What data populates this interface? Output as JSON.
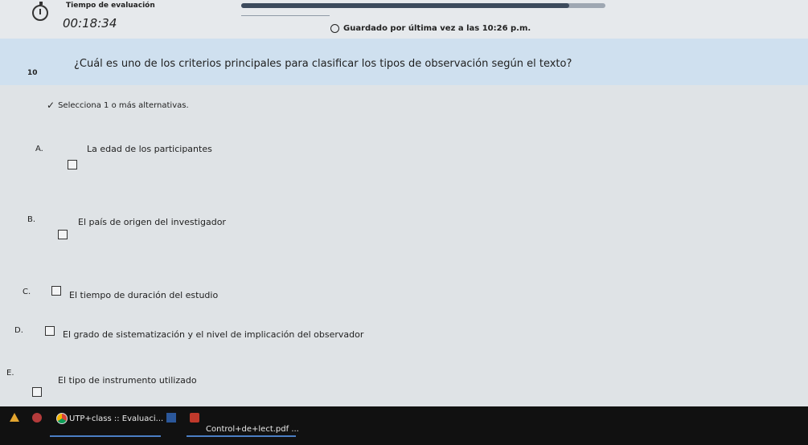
{
  "timer": {
    "title": "Tiempo de evaluación",
    "value": "00:18:34",
    "progress_fraction": 0.9
  },
  "saved": {
    "text": "Guardado por última vez a las 10:26 p.m."
  },
  "question": {
    "number": "10",
    "text": "¿Cuál es uno de los criterios principales para clasificar los tipos de observación según el texto?",
    "hint": "Selecciona 1 o más alternativas.",
    "options": [
      {
        "letter": "A.",
        "text": "La edad de los participantes",
        "checked": false
      },
      {
        "letter": "B.",
        "text": "El país de origen del investigador",
        "checked": false
      },
      {
        "letter": "C.",
        "text": "El tiempo de duración del estudio",
        "checked": false
      },
      {
        "letter": "D.",
        "text": "El grado de sistematización y el nivel de implicación del observador",
        "checked": false
      },
      {
        "letter": "E.",
        "text": "El tipo de instrumento utilizado",
        "checked": false
      }
    ]
  },
  "taskbar": {
    "apps": [
      {
        "label": "UTP+class :: Evaluaci...",
        "icon": "chrome-icon"
      },
      {
        "label": "Control+de+lect.pdf ...",
        "icon": "pdf-icon"
      }
    ]
  },
  "colors": {
    "question_bar": "#cfe0ef",
    "page_bg": "#dfe3e6",
    "taskbar": "#111111",
    "progress_fill": "#3c4a5c"
  }
}
